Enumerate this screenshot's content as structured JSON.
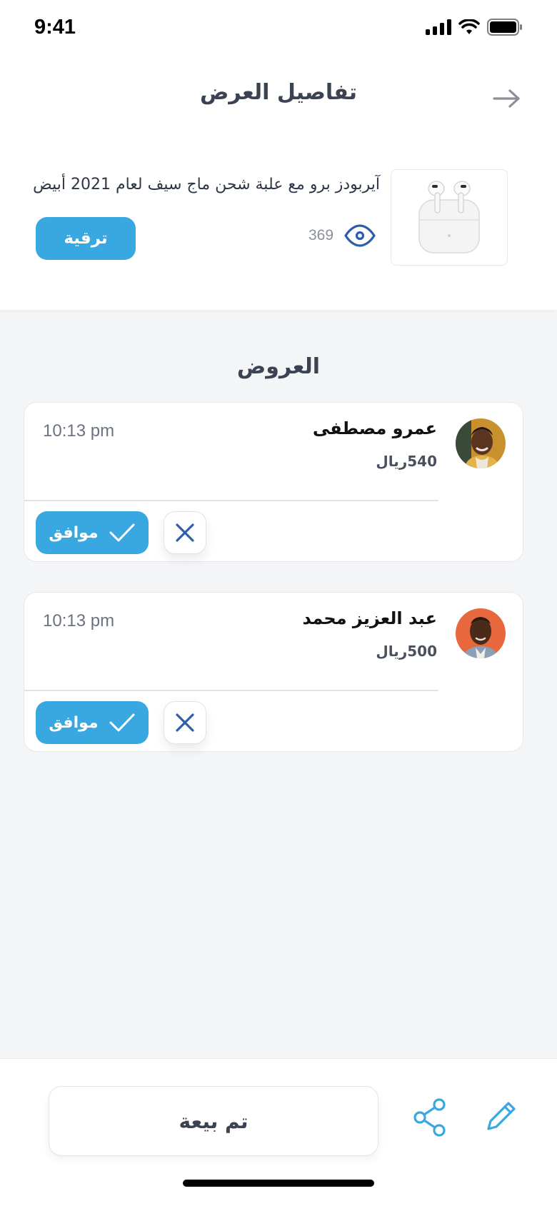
{
  "status_bar": {
    "time": "9:41"
  },
  "header": {
    "title": "تفاصيل العرض"
  },
  "product": {
    "name": "آيربودز برو مع علبة شحن ماج سيف لعام 2021 أبيض",
    "views": "369",
    "upgrade_label": "ترقية"
  },
  "offers_section": {
    "title": "العروض"
  },
  "offers": [
    {
      "name": "عمرو مصطفى",
      "price": "540ريال",
      "time": "10:13 pm",
      "accept_label": "موافق"
    },
    {
      "name": "عبد العزيز محمد",
      "price": "500ريال",
      "time": "10:13 pm",
      "accept_label": "موافق"
    }
  ],
  "bottom": {
    "sold_label": "تم بيعة"
  },
  "colors": {
    "accent": "#3aa8e0",
    "icon_blue": "#2f5ea8",
    "background": "#f4f5f7"
  }
}
